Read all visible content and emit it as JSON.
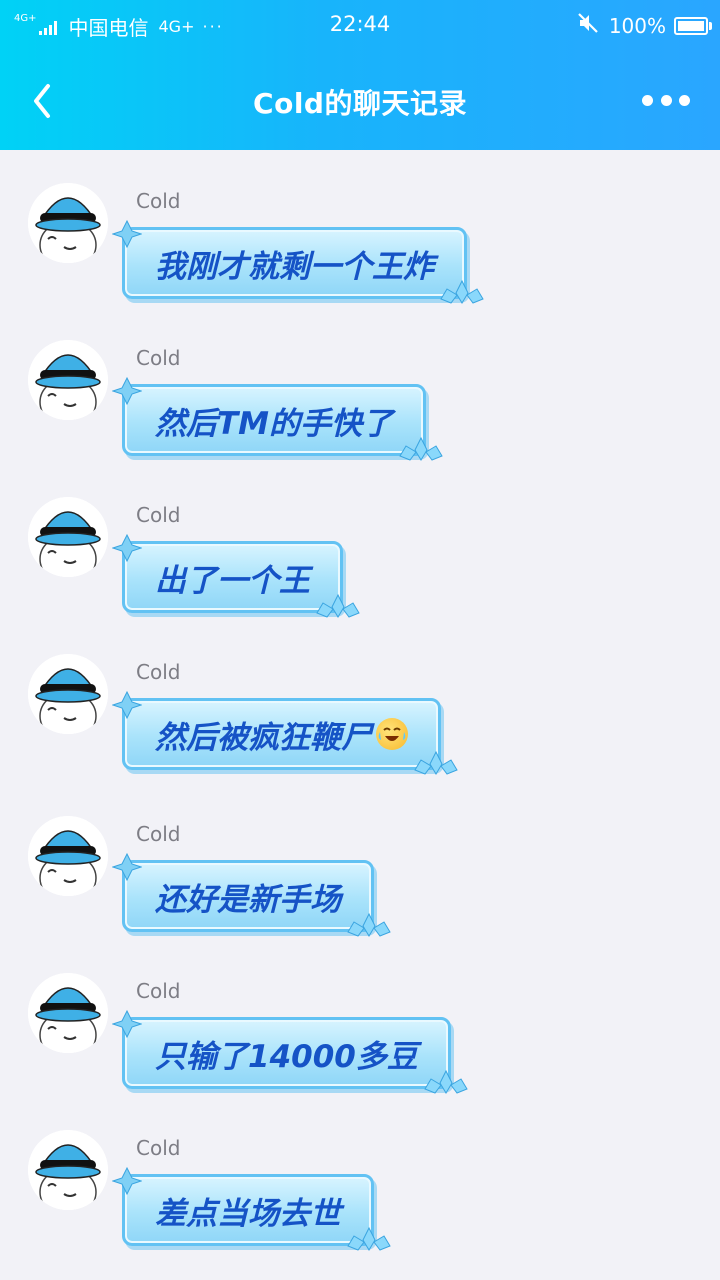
{
  "status_bar": {
    "network_small": "4G+",
    "carrier": "中国电信",
    "network": "4G+",
    "more": "···",
    "time": "22:44",
    "battery": "100%"
  },
  "header": {
    "title": "Cold的聊天记录"
  },
  "messages": [
    {
      "sender": "Cold",
      "text": "我刚才就剩一个王炸"
    },
    {
      "sender": "Cold",
      "text": "然后TM的手快了"
    },
    {
      "sender": "Cold",
      "text": "出了一个王"
    },
    {
      "sender": "Cold",
      "text": "然后被疯狂鞭尸",
      "emoji": "crying-laughing-emoji"
    },
    {
      "sender": "Cold",
      "text": "还好是新手场"
    },
    {
      "sender": "Cold",
      "text": "只输了14000多豆"
    },
    {
      "sender": "Cold",
      "text": "差点当场去世"
    }
  ],
  "colors": {
    "header_gradient_start": "#00d2f6",
    "header_gradient_end": "#2aa6ff",
    "background": "#f2f2f7",
    "bubble_text": "#1553c6"
  }
}
